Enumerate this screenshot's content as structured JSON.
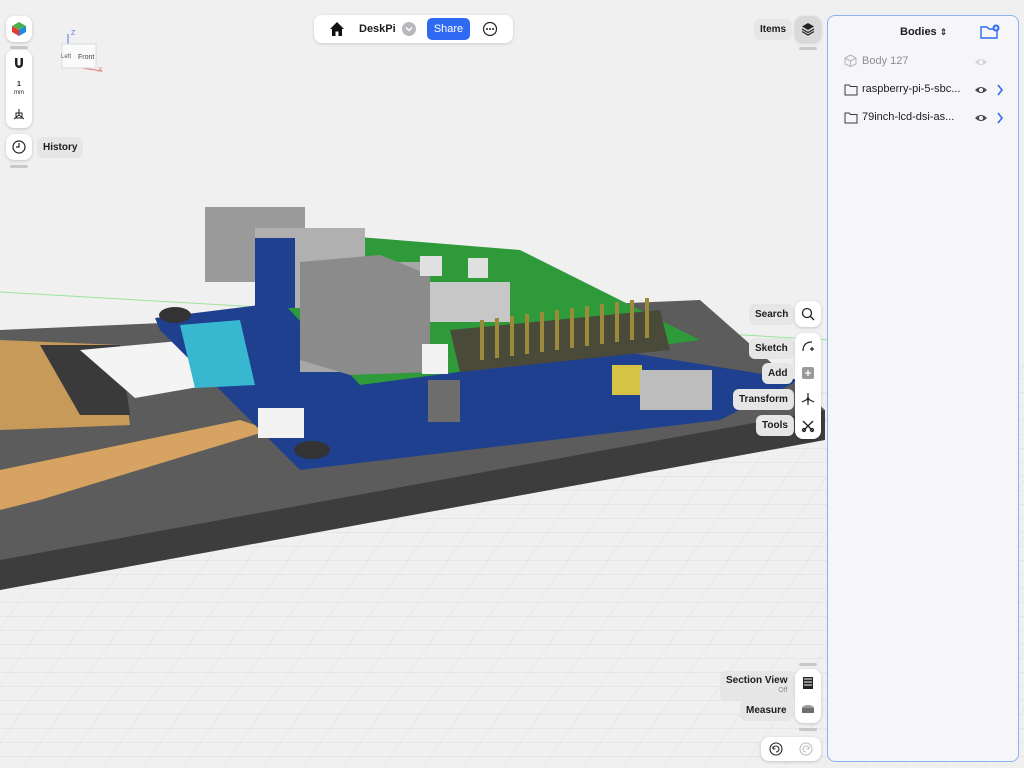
{
  "topbar": {
    "title": "DeskPi",
    "share_label": "Share"
  },
  "viewcube": {
    "left_label": "Left",
    "front_label": "Front",
    "z_label": "Z",
    "x_label": "X"
  },
  "left_tools": {
    "units_value": "1",
    "units_unit": "mm",
    "history_label": "History"
  },
  "items_label": "Items",
  "right_tools": {
    "search": "Search",
    "sketch": "Sketch",
    "add": "Add",
    "transform": "Transform",
    "tools": "Tools",
    "section_view": "Section View",
    "section_view_state": "Off",
    "measure": "Measure"
  },
  "panel": {
    "title": "Bodies",
    "rows": [
      {
        "label": "Body 127",
        "muted": true
      },
      {
        "label": "raspberry-pi-5-sbc...",
        "muted": false
      },
      {
        "label": "79inch-lcd-dsi-as...",
        "muted": false
      }
    ]
  },
  "colors": {
    "accent": "#2f6bf2",
    "pcb_blue": "#1f3f8f",
    "pcb_green": "#2e9a3a"
  }
}
